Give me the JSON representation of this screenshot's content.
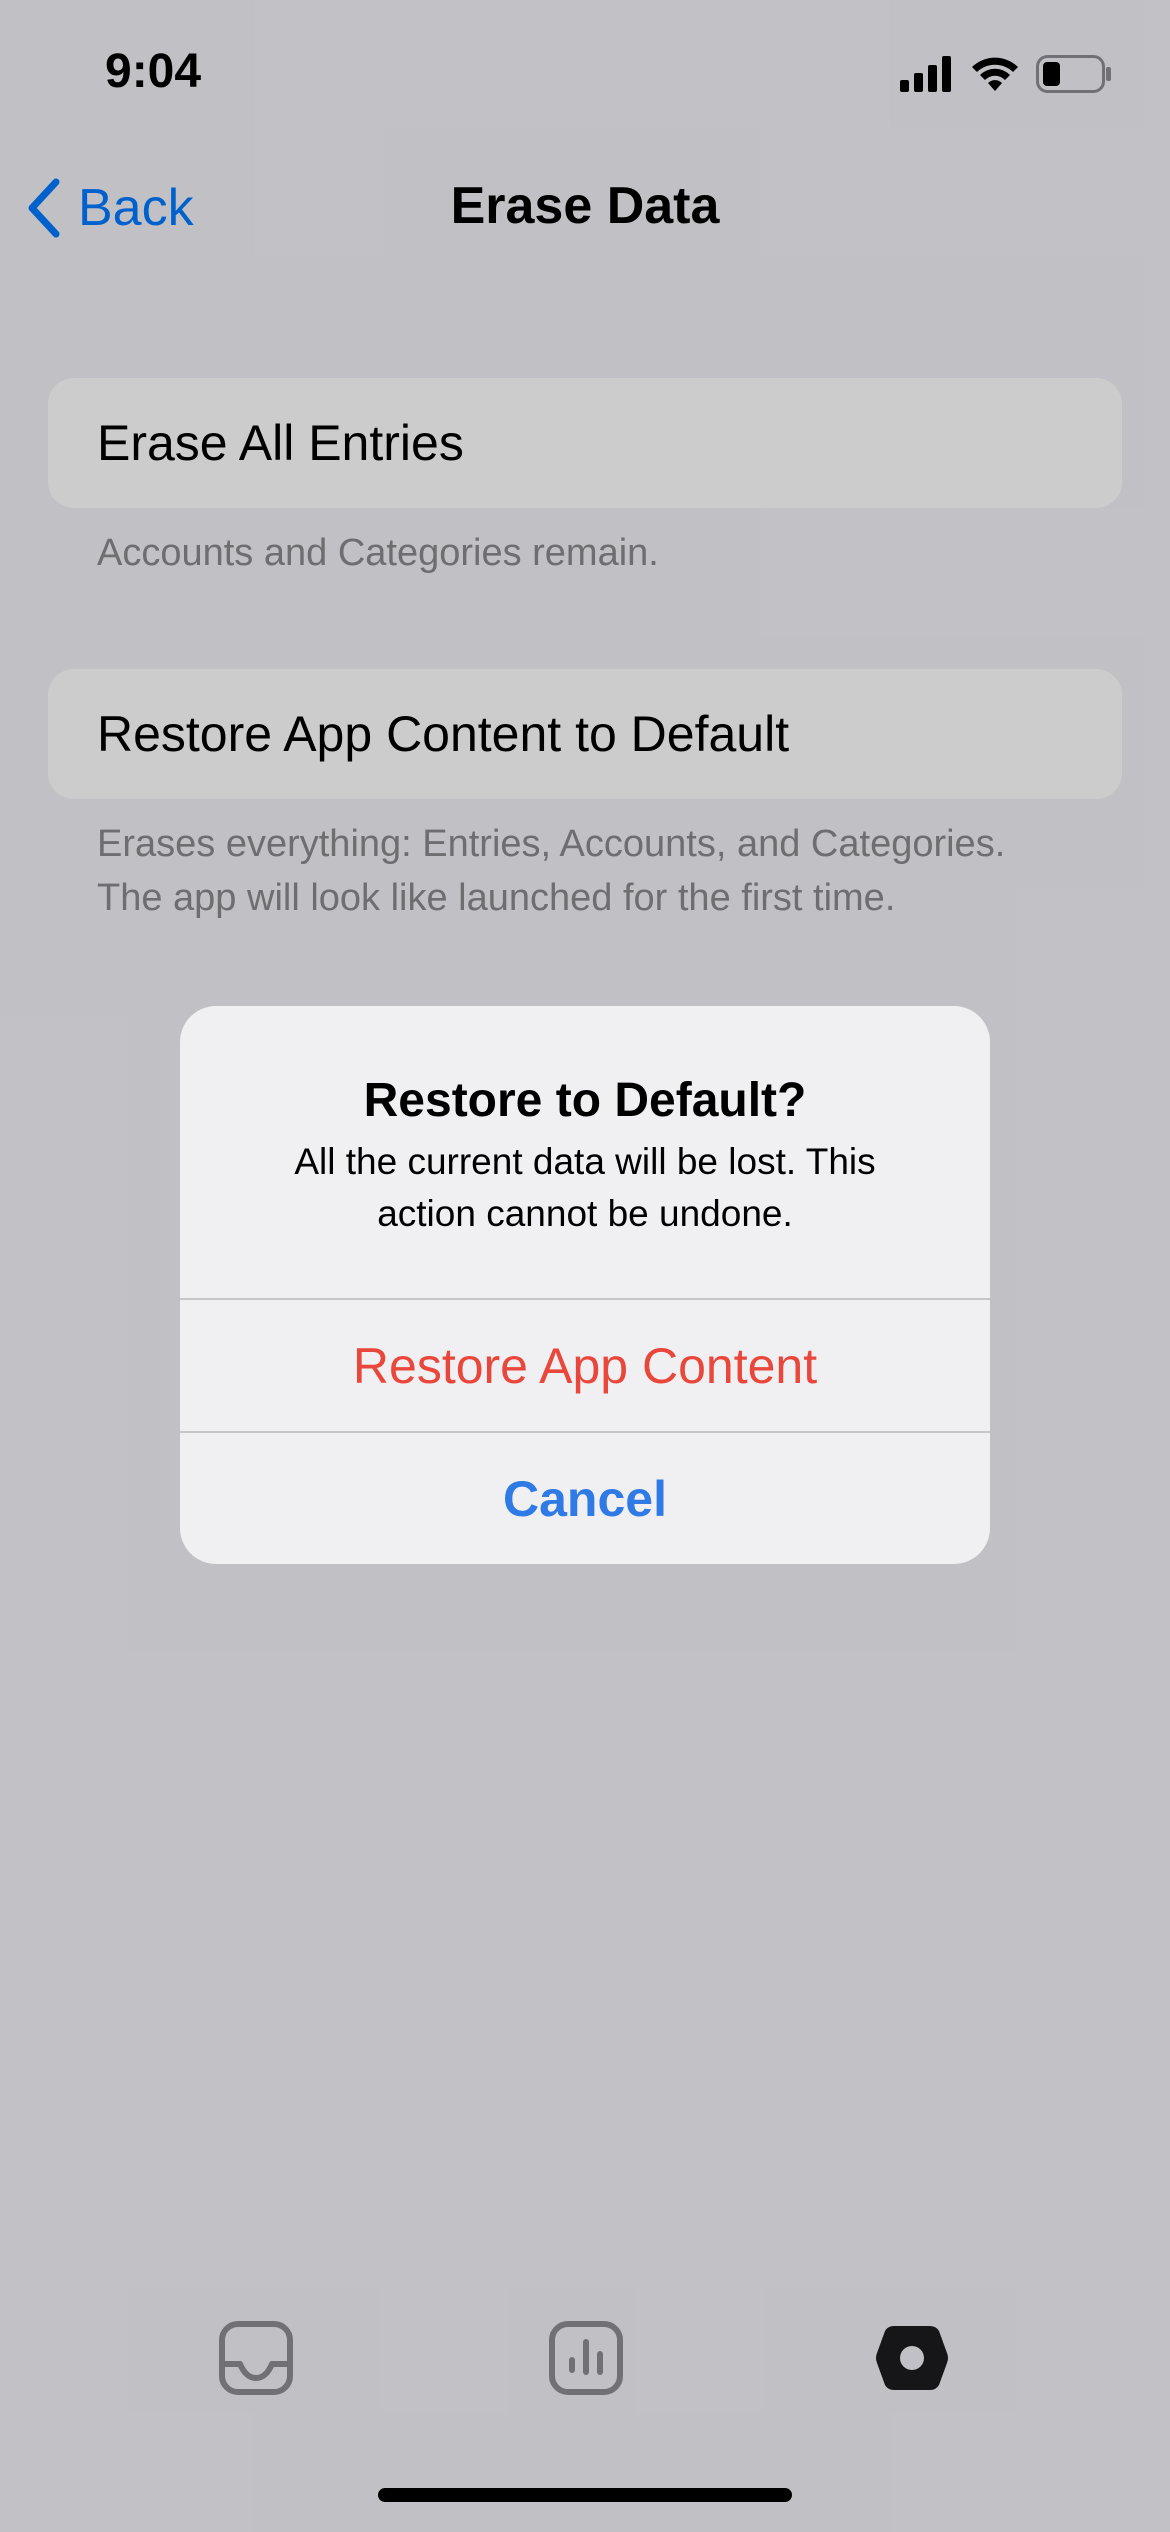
{
  "status_bar": {
    "time": "9:04"
  },
  "nav": {
    "back_label": "Back",
    "title": "Erase Data"
  },
  "settings": {
    "erase_all": {
      "label": "Erase All Entries",
      "footer": "Accounts and Categories remain."
    },
    "restore_default": {
      "label": "Restore App Content to Default",
      "footer_line1": "Erases everything: Entries, Accounts, and Categories.",
      "footer_line2": "The app will look like launched for the first time."
    }
  },
  "alert": {
    "title": "Restore to Default?",
    "message_line1": "All the current data will be lost. This",
    "message_line2": "action cannot be undone.",
    "destructive_button": "Restore App Content",
    "cancel_button": "Cancel"
  },
  "tab_bar": {
    "tabs": [
      {
        "icon": "inbox-icon",
        "selected": false
      },
      {
        "icon": "chart-icon",
        "selected": false
      },
      {
        "icon": "settings-gear-icon",
        "selected": true
      }
    ]
  },
  "colors": {
    "destructive": "#e9473b",
    "accent": "#2f7ae5",
    "background": "#f2f2f7"
  }
}
